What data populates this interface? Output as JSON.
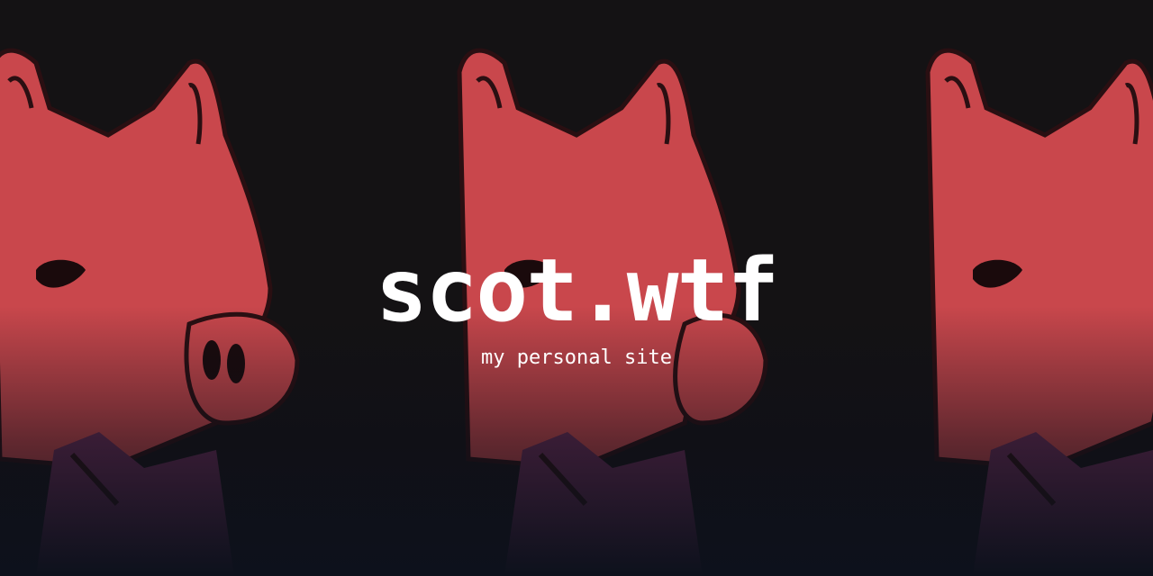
{
  "site": {
    "title": "scot.wtf",
    "subtitle": "my personal site"
  },
  "hero": {
    "image_subject": "repeated pink pig heads illustration",
    "colors": {
      "background_dark": "#141214",
      "pig_fill": "#c9474c",
      "pig_outline": "#2a0f12",
      "shirt_fill": "#6b2c57",
      "fade_bottom": "#0d111c",
      "text": "#ffffff"
    }
  }
}
